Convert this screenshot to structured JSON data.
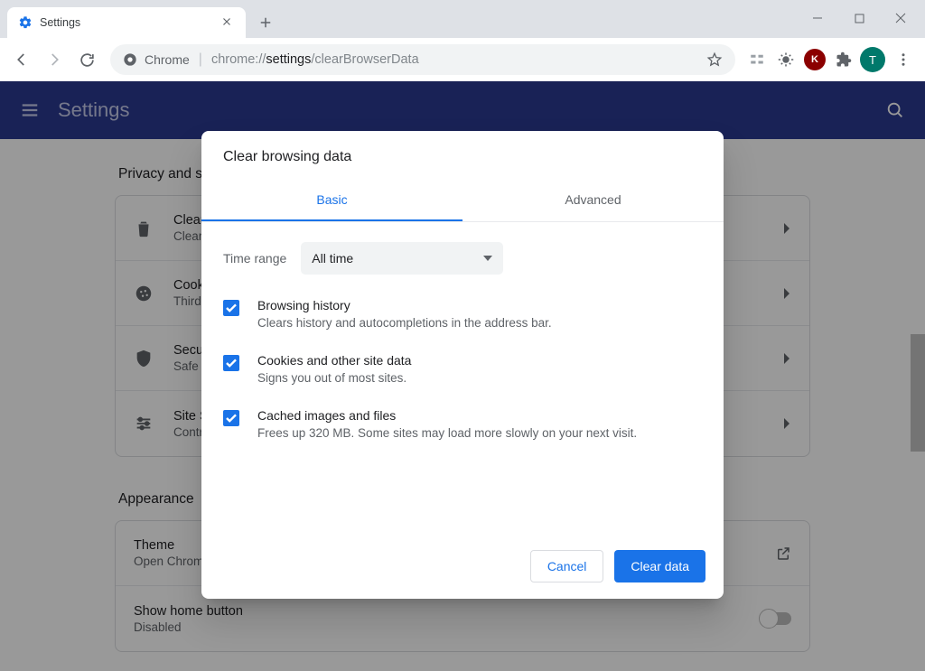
{
  "window": {
    "tab_title": "Settings",
    "url_prefix": "Chrome",
    "url_path_dark": "chrome://",
    "url_path_bold": "settings",
    "url_path_rest": "/clearBrowserData",
    "avatar_initial": "T"
  },
  "settings_header": {
    "title": "Settings"
  },
  "sections": {
    "privacy": {
      "heading": "Privacy and security",
      "rows": [
        {
          "icon": "trash",
          "title": "Clear browsing data",
          "desc": "Clear history, cookies, cache, and more"
        },
        {
          "icon": "cookie",
          "title": "Cookies and other site data",
          "desc": "Third-party cookies are blocked in Incognito mode"
        },
        {
          "icon": "shield",
          "title": "Security",
          "desc": "Safe Browsing (protection from dangerous sites) and other security settings"
        },
        {
          "icon": "sliders",
          "title": "Site Settings",
          "desc": "Controls what information sites can use and show"
        }
      ]
    },
    "appearance": {
      "heading": "Appearance",
      "theme": {
        "title": "Theme",
        "desc": "Open Chrome Web Store"
      },
      "home": {
        "title": "Show home button",
        "desc": "Disabled"
      }
    }
  },
  "dialog": {
    "title": "Clear browsing data",
    "tabs": {
      "basic": "Basic",
      "advanced": "Advanced"
    },
    "time_range_label": "Time range",
    "time_range_value": "All time",
    "items": [
      {
        "title": "Browsing history",
        "desc": "Clears history and autocompletions in the address bar."
      },
      {
        "title": "Cookies and other site data",
        "desc": "Signs you out of most sites."
      },
      {
        "title": "Cached images and files",
        "desc": "Frees up 320 MB. Some sites may load more slowly on your next visit."
      }
    ],
    "cancel": "Cancel",
    "confirm": "Clear data"
  }
}
